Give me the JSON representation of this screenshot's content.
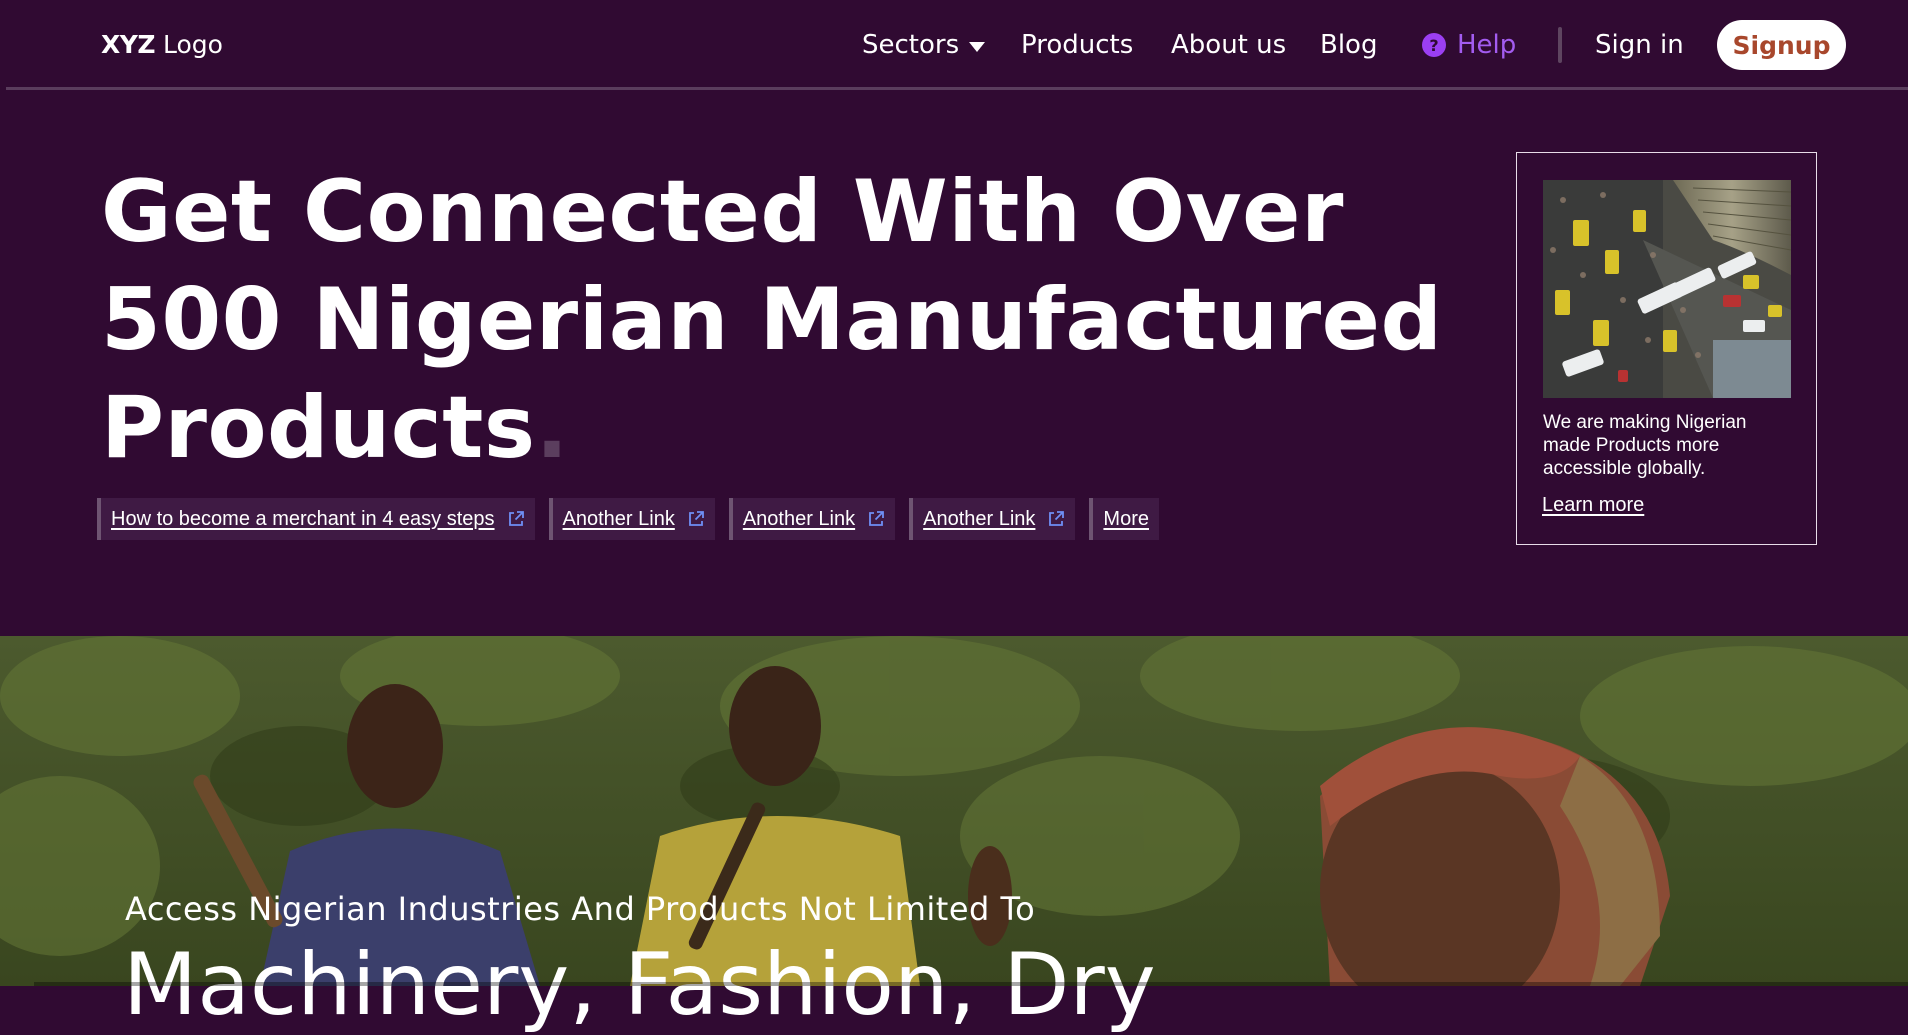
{
  "header": {
    "logo_bold": "XYZ",
    "logo_rest": "Logo",
    "nav": {
      "sectors": "Sectors",
      "products": "Products",
      "about": "About us",
      "blog": "Blog",
      "help": "Help",
      "signin": "Sign in",
      "signup": "Signup"
    },
    "help_icon_glyph": "?"
  },
  "hero": {
    "title_line1": "Get Connected With Over",
    "title_line2": "500 Nigerian Manufactured",
    "title_line3": "Products",
    "title_dot": ".",
    "links": [
      {
        "label": "How to become a merchant in 4 easy steps",
        "icon": "external-link-icon"
      },
      {
        "label": "Another Link",
        "icon": "external-link-icon"
      },
      {
        "label": "Another Link",
        "icon": "external-link-icon"
      },
      {
        "label": "Another Link",
        "icon": "external-link-icon"
      },
      {
        "label": "More"
      }
    ]
  },
  "card": {
    "text": "We are making Nigerian made Products more accessible globally.",
    "link": "Learn more"
  },
  "band": {
    "subtitle": "Access Nigerian Industries And Products Not Limited To",
    "headline": "Machinery, Fashion, Dry"
  },
  "colors": {
    "background": "#300a32",
    "help_accent": "#a35cf0",
    "signup_text": "#a8472c",
    "link_icon": "#6f8ff5"
  }
}
